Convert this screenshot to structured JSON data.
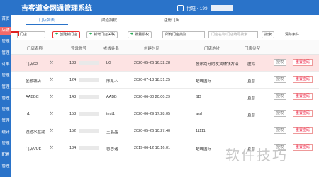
{
  "header": {
    "title": "吉客道全网通管理系统",
    "user": "付晓 - 199"
  },
  "sidebar": {
    "items": [
      {
        "label": "首页"
      },
      {
        "label": "店铺",
        "active": true
      },
      {
        "label": "管理"
      },
      {
        "label": "管理"
      },
      {
        "label": "订单"
      },
      {
        "label": "管理"
      },
      {
        "label": "管理"
      },
      {
        "label": "管理"
      },
      {
        "label": "管理"
      },
      {
        "label": "管理"
      },
      {
        "label": "统计"
      },
      {
        "label": "管理"
      },
      {
        "label": "配置"
      },
      {
        "label": "管理"
      }
    ]
  },
  "tabs": [
    {
      "label": "门店列表",
      "active": true
    },
    {
      "label": "渠道授权",
      "active": false
    },
    {
      "label": "注册门店",
      "active": false
    }
  ],
  "toolbar": {
    "filter_prefix": "门店",
    "create_store": "创建新门店",
    "add_link": "新增门店关联",
    "batch_auth": "批量授权",
    "store_type": "所有门店类别",
    "search_placeholder": "门店名称/门店编号搜索",
    "search_btn": "搜索",
    "clear": "清除条件"
  },
  "table": {
    "headers": [
      "门店名称",
      "登录账号",
      "老板姓名",
      "创建时间",
      "门店地址",
      "门店类型"
    ],
    "rows": [
      {
        "name": "门店02",
        "account": "138",
        "boss": "LG",
        "created": "2020-05-26 16:32:28",
        "address": "胶东路分的发货赚钱方法",
        "type": "虚拟",
        "highlight": true
      },
      {
        "name": "金融城店",
        "account": "124",
        "boss": "陈某人",
        "created": "2020-07-13 18:31:25",
        "address": "楚峰国际",
        "type": "直营",
        "highlight": false
      },
      {
        "name": "AABBC",
        "account": "143",
        "boss": "AABB",
        "created": "2020-06-30 20:00:29",
        "address": "SD",
        "type": "直营",
        "highlight": false
      },
      {
        "name": "h1",
        "account": "153",
        "boss": "test1",
        "created": "2020-06-29 17:28:05",
        "address": "asd",
        "type": "直营",
        "highlight": false
      },
      {
        "name": "渡越水盆湖",
        "account": "152",
        "boss": "王晶晶",
        "created": "2020-05-26 10:27:40",
        "address": "11111",
        "type": "",
        "highlight": false
      },
      {
        "name": "门店VUE",
        "account": "134",
        "boss": "蓉蓉诸",
        "created": "2019-06-12 10:16:01",
        "address": "楚峰国际",
        "type": "直营",
        "highlight": false
      }
    ],
    "actions": {
      "auth": "授权",
      "reset": "重置密码"
    }
  },
  "watermark": "软件技巧"
}
